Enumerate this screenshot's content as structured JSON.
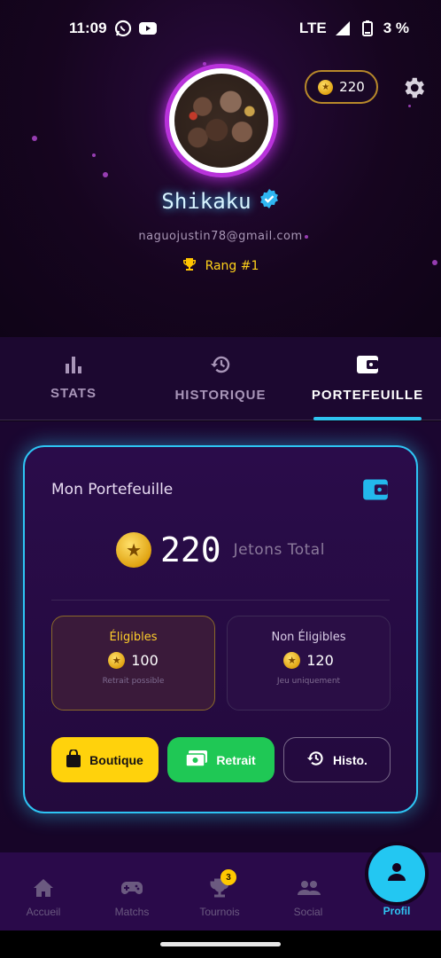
{
  "status_bar": {
    "time": "11:09",
    "network": "LTE",
    "battery": "3 %",
    "icons": [
      "whatsapp-icon",
      "youtube-icon",
      "signal-icon",
      "battery-icon"
    ]
  },
  "header": {
    "coins": "220",
    "username": "Shikaku",
    "email": "naguojustin78@gmail.com",
    "rank": "Rang #1"
  },
  "tabs": [
    {
      "label": "STATS",
      "icon": "bar-chart-icon",
      "active": false
    },
    {
      "label": "HISTORIQUE",
      "icon": "history-icon",
      "active": false
    },
    {
      "label": "PORTEFEUILLE",
      "icon": "wallet-icon",
      "active": true
    }
  ],
  "wallet": {
    "title": "Mon Portefeuille",
    "total": "220",
    "total_label": "Jetons Total",
    "eligible": {
      "title": "Éligibles",
      "amount": "100",
      "note": "Retrait possible"
    },
    "not_eligible": {
      "title": "Non Éligibles",
      "amount": "120",
      "note": "Jeu uniquement"
    },
    "buttons": {
      "shop": "Boutique",
      "withdraw": "Retrait",
      "history": "Histo."
    }
  },
  "bottom_nav": {
    "items": [
      {
        "label": "Accueil",
        "icon": "home-icon"
      },
      {
        "label": "Matchs",
        "icon": "gamepad-icon"
      },
      {
        "label": "Tournois",
        "icon": "trophy-icon",
        "badge": "3"
      },
      {
        "label": "Social",
        "icon": "people-icon"
      }
    ],
    "active": {
      "label": "Profil",
      "icon": "person-icon"
    }
  },
  "colors": {
    "accent": "#2ec5f4",
    "gold": "#ffd20c",
    "green": "#1fc855",
    "purple_glow": "#c63be3"
  }
}
